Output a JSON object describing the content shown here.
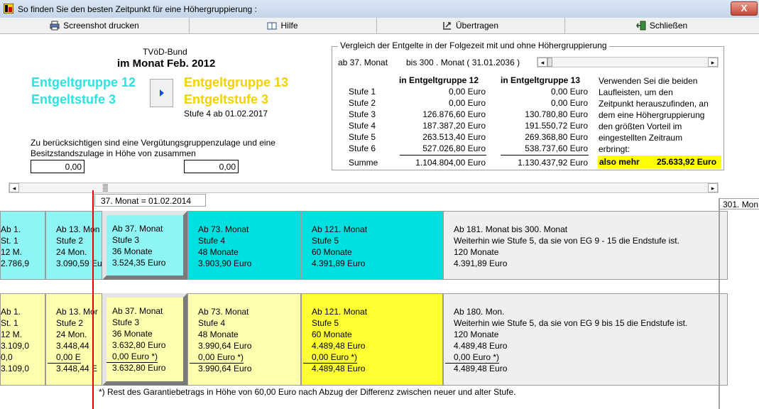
{
  "window": {
    "title": "So finden Sie den besten Zeitpunkt für eine Höhergruppierung :",
    "close_label": "X"
  },
  "toolbar": {
    "print": "Screenshot drucken",
    "help": "Hilfe",
    "transfer": "Übertragen",
    "close": "Schließen"
  },
  "header": {
    "tariff": "TVöD-Bund",
    "month": "im Monat Feb. 2012"
  },
  "current": {
    "group": "Entgeltgruppe 12",
    "level": "Entgeltstufe 3"
  },
  "target": {
    "group": "Entgeltgruppe 13",
    "level": "Entgeltstufe 3",
    "next": "Stufe 4 ab  01.02.2017"
  },
  "allowance": {
    "text_line1": "Zu berücksichtigen sind eine Vergütungsgruppenzulage und eine",
    "text_line2": "Besitzstandszulage in Höhe von zusammen",
    "value1": "0,00",
    "value2": "0,00"
  },
  "comparison": {
    "legend": "Vergleich der Entgelte in der Folgezeit mit und ohne Höhergruppierung",
    "range_from": "ab  37. Monat",
    "range_to": "bis  300 . Monat ( 31.01.2036  )",
    "col1": "in Entgeltgruppe 12",
    "col2": "in Entgeltgruppe 13",
    "rows": [
      {
        "label": "Stufe 1",
        "a": "0,00 Euro",
        "b": "0,00 Euro"
      },
      {
        "label": "Stufe 2",
        "a": "0,00 Euro",
        "b": "0,00 Euro"
      },
      {
        "label": "Stufe 3",
        "a": "126.876,60 Euro",
        "b": "130.780,80 Euro"
      },
      {
        "label": "Stufe 4",
        "a": "187.387,20 Euro",
        "b": "191.550,72 Euro"
      },
      {
        "label": "Stufe 5",
        "a": "263.513,40 Euro",
        "b": "269.368,80 Euro"
      },
      {
        "label": "Stufe 6",
        "a": "527.026,80 Euro",
        "b": "538.737,60 Euro"
      }
    ],
    "sum_label": "Summe",
    "sum_a": "1.104.804,00 Euro",
    "sum_b": "1.130.437,92 Euro",
    "hint": [
      "Verwenden Sei die beiden",
      "Laufleisten, um den",
      "Zeitpunkt herauszufinden, an",
      "dem eine Höhergruppierung",
      "den größten Vorteil im",
      "eingestellten Zeitraum",
      "erbringt:"
    ],
    "more_label": "also mehr",
    "more_value": "25.633,92 Euro"
  },
  "timeline": {
    "marker_label": "37. Monat  = 01.02.2014",
    "end_label": "301. Mon"
  },
  "row1": [
    {
      "lines": [
        "Ab 1.",
        "St. 1",
        "12 M.",
        "2.786,9"
      ]
    },
    {
      "lines": [
        "Ab 13. Mon",
        "Stufe 2",
        "24 Mon.",
        "3.090,59 Eu"
      ]
    },
    {
      "lines": [
        "Ab 37. Monat",
        "Stufe 3",
        "36 Monate",
        "3.524,35 Euro"
      ]
    },
    {
      "lines": [
        "Ab 73. Monat",
        "Stufe 4",
        "48 Monate",
        "3.903,90 Euro"
      ]
    },
    {
      "lines": [
        "Ab 121. Monat",
        "Stufe 5",
        "60 Monate",
        "4.391,89 Euro"
      ]
    },
    {
      "lines": [
        "Ab 181. Monat bis  300. Monat",
        "Weiterhin wie Stufe 5, da sie von EG 9 - 15 die Endstufe ist.",
        "120 Monate",
        "4.391,89 Euro"
      ]
    }
  ],
  "row2": [
    {
      "lines": [
        "Ab 1.",
        "St. 1",
        "12 M.",
        "3.109,0",
        "0,0",
        "3.109,0"
      ]
    },
    {
      "lines": [
        "Ab 13. Mor",
        "Stufe 2",
        "24 Mon.",
        "3.448,44",
        "0,00 E",
        "3.448,44 E"
      ]
    },
    {
      "lines": [
        "Ab 37. Monat",
        "Stufe 3",
        "36 Monate",
        "3.632,80 Euro",
        "0,00 Euro *)",
        "3.632,80 Euro"
      ]
    },
    {
      "lines": [
        "Ab 73. Monat",
        "Stufe 4",
        "48 Monate",
        "3.990,64 Euro",
        "0,00 Euro *)",
        "3.990,64 Euro"
      ]
    },
    {
      "lines": [
        "Ab 121. Monat",
        "Stufe 5",
        "60 Monate",
        "4.489,48 Euro",
        "0,00 Euro *)",
        "4.489,48 Euro"
      ]
    },
    {
      "lines": [
        "Ab 180. Mon.",
        "Weiterhin wie Stufe 5, da sie von EG 9 bis 15 die Endstufe ist.",
        "120 Monate",
        "4.489,48 Euro",
        "0,00 Euro *)",
        "4.489,48 Euro"
      ]
    }
  ],
  "footnote": "*) Rest des Garantiebetrags in Höhe von  60,00    Euro nach Abzug der Differenz zwischen neuer und alter Stufe.",
  "colors": {
    "cyan_text": "#33e0e0",
    "yellow_text": "#f2d200",
    "cyan_cell": "#00e0e0",
    "light_cyan_cell": "#8ff4f4",
    "yellow_cell": "#ffff33",
    "light_yellow_cell": "#ffffb0",
    "grey_cell": "#efefef",
    "marker_line": "#e00000",
    "highlight": "#ffff00"
  }
}
